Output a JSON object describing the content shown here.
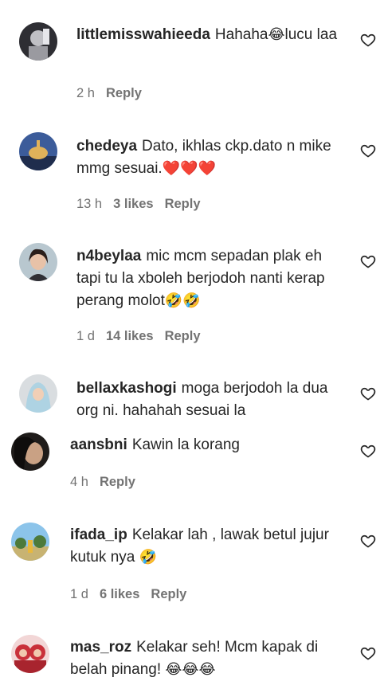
{
  "comments": [
    {
      "username": "littlemisswahieeda",
      "text_before": "Hahaha",
      "emoji": "😂",
      "text_after": "lucu laa",
      "time": "2 h",
      "likes": "",
      "reply": "Reply"
    },
    {
      "username": "chedeya",
      "text_before": "Dato, ikhlas ckp.dato n mike mmg sesuai.",
      "emoji": "❤️❤️❤️",
      "text_after": "",
      "time": "13 h",
      "likes": "3 likes",
      "reply": "Reply"
    },
    {
      "username": "n4beylaa",
      "text_before": "mic mcm sepadan plak eh tapi tu la xboleh berjodoh nanti kerap perang molot",
      "emoji": "🤣🤣",
      "text_after": "",
      "time": "1 d",
      "likes": "14 likes",
      "reply": "Reply"
    },
    {
      "username": "bellaxkashogi",
      "text_before": "moga berjodoh la dua org ni. hahahah sesuai la",
      "emoji": "",
      "text_after": "",
      "time": "",
      "likes": "",
      "reply": ""
    },
    {
      "username": "aansbni",
      "text_before": "Kawin la korang",
      "emoji": "",
      "text_after": "",
      "time": "4 h",
      "likes": "",
      "reply": "Reply"
    },
    {
      "username": "ifada_ip",
      "text_before": "Kelakar lah , lawak betul jujur kutuk nya",
      "emoji": "🤣",
      "text_after": "",
      "time": "1 d",
      "likes": "6 likes",
      "reply": "Reply"
    },
    {
      "username": "mas_roz",
      "text_before": "Kelakar seh! Mcm kapak di belah pinang!",
      "emoji": "😂😂😂",
      "text_after": "",
      "time": "",
      "likes": "",
      "reply": ""
    }
  ],
  "icons": {
    "heart": "heart-outline-icon"
  },
  "colors": {
    "text": "#262626",
    "meta": "#737373"
  }
}
